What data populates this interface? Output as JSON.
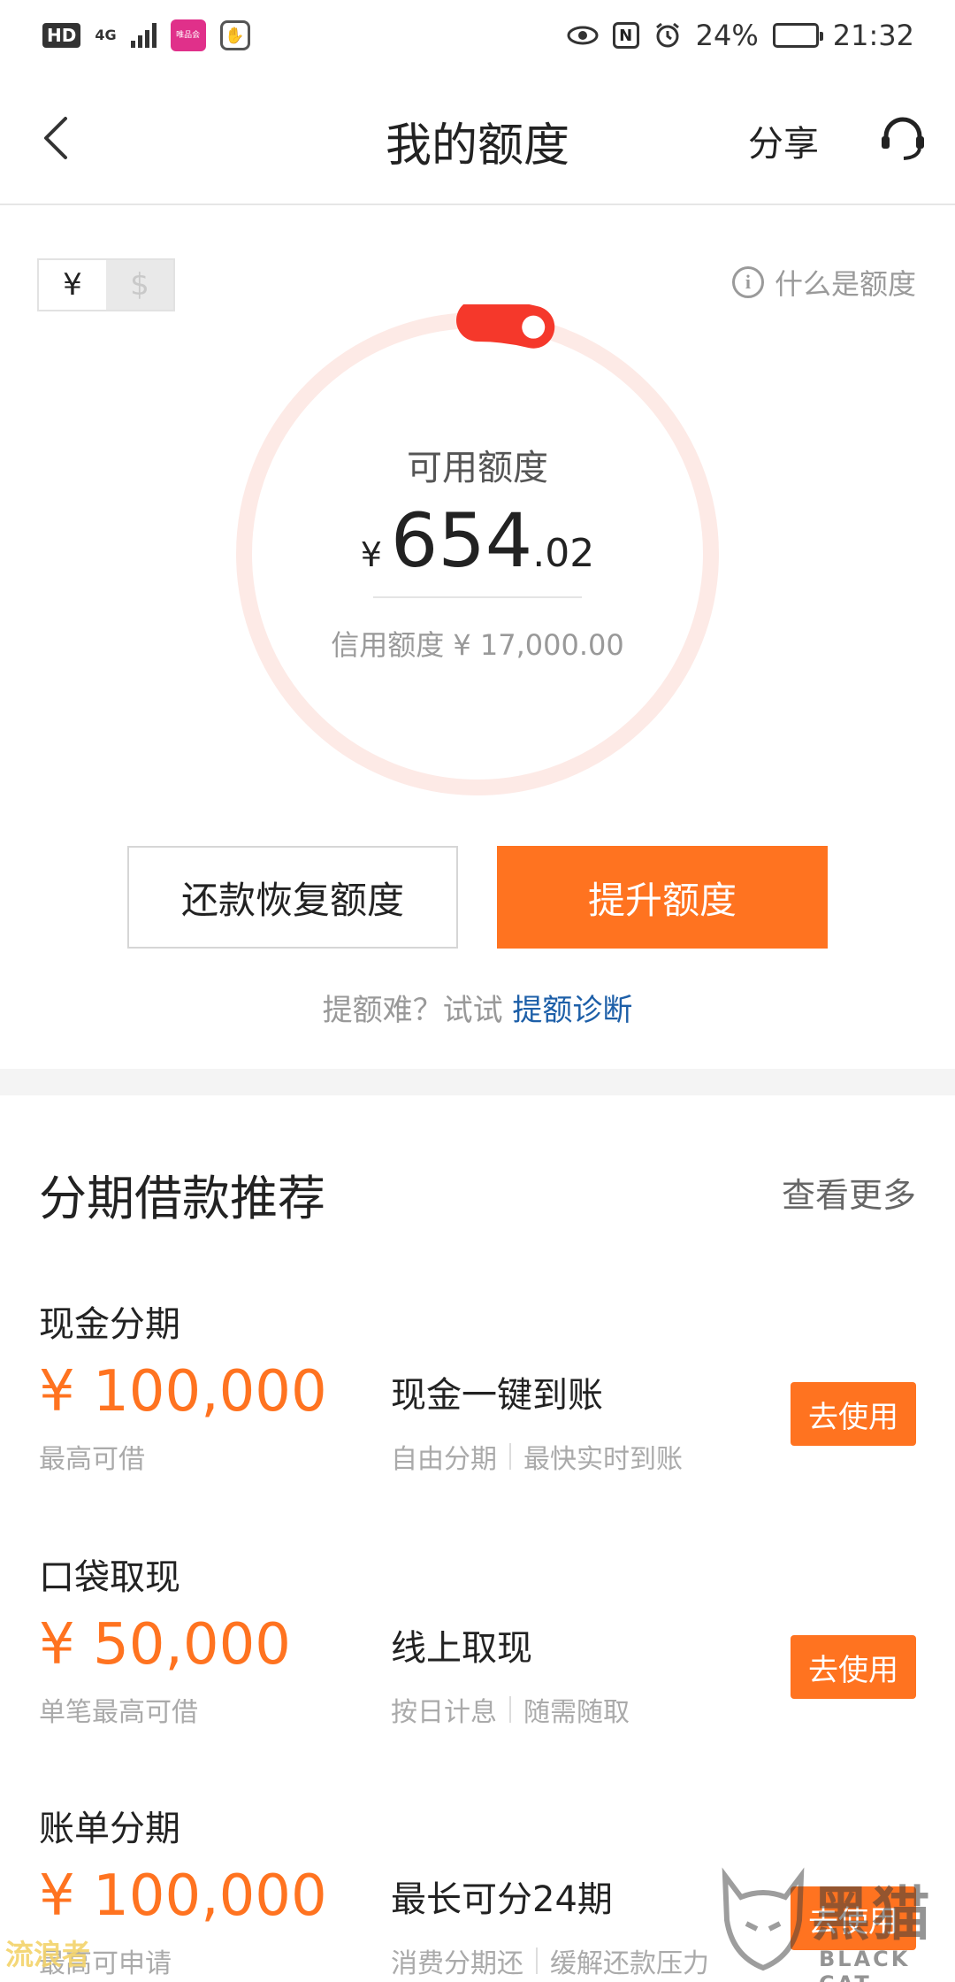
{
  "status_bar": {
    "hd": "HD",
    "network": "4G",
    "app_badge": "唯品会",
    "battery_percent": "24%",
    "battery_level": 0.24,
    "time": "21:32",
    "nfc": "N"
  },
  "nav": {
    "title": "我的额度",
    "share_label": "分享"
  },
  "quota": {
    "currency_cny": "¥",
    "currency_usd": "$",
    "what_is": "什么是额度",
    "info_glyph": "i",
    "available_label": "可用额度",
    "available_symbol": "¥",
    "available_integer": "654",
    "available_decimal": ".02",
    "credit_limit": "信用额度 ¥ 17,000.00",
    "used_fraction": 0.0385,
    "ring_track_color": "#fdeae6",
    "ring_progress_color": "#f5382b",
    "restore_button": "还款恢复额度",
    "raise_button": "提升额度",
    "diag_prefix": "提额难？试试",
    "diag_link": "提额诊断"
  },
  "colors": {
    "accent": "#ff7320",
    "link": "#1d5fa8"
  },
  "recommend": {
    "title": "分期借款推荐",
    "more": "查看更多",
    "products": [
      {
        "name": "现金分期",
        "amount": "¥ 100,000",
        "amount_label": "最高可借",
        "desc": "现金一键到账",
        "tags": [
          "自由分期",
          "最快实时到账"
        ],
        "button": "去使用"
      },
      {
        "name": "口袋取现",
        "amount": "¥ 50,000",
        "amount_label": "单笔最高可借",
        "desc": "线上取现",
        "tags": [
          "按日计息",
          "随需随取"
        ],
        "button": "去使用"
      },
      {
        "name": "账单分期",
        "amount": "¥ 100,000",
        "amount_label": "最高可申请",
        "desc": "最长可分24期",
        "tags": [
          "消费分期还",
          "缓解还款压力"
        ],
        "button": "去使用"
      }
    ]
  },
  "watermark": {
    "left": "流浪者",
    "right_cn": "黑猫",
    "right_en": "BLACK CAT"
  }
}
